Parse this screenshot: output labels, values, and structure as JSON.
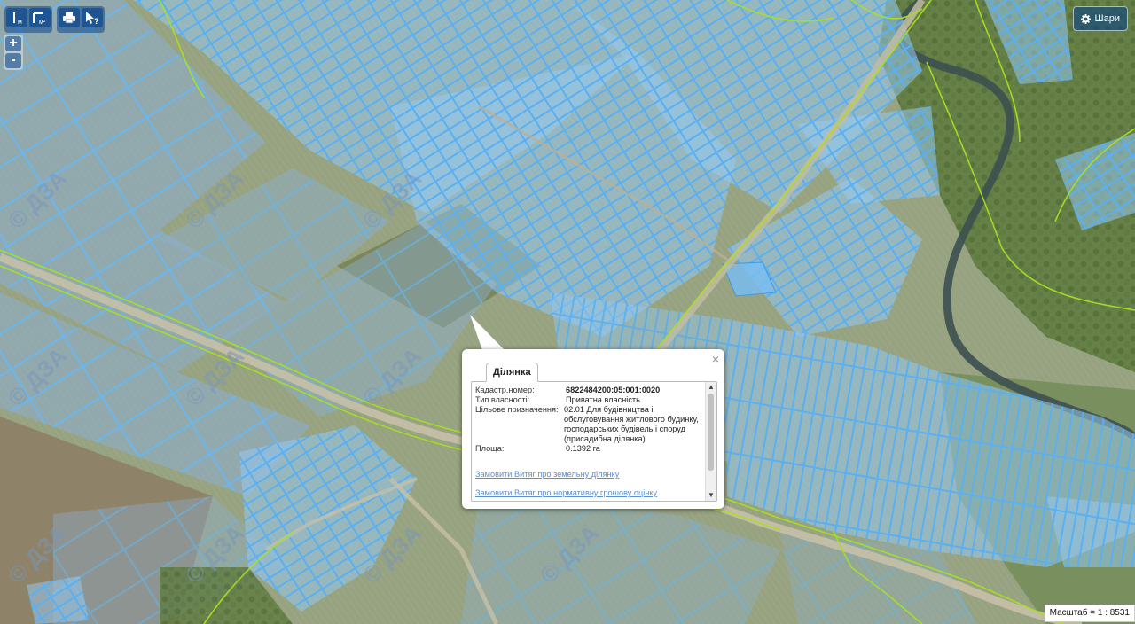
{
  "toolbar": {
    "measure_length_label": "м",
    "measure_area_label": "м²",
    "print_tool": "print-icon",
    "identify_tool": "pointer-question-icon"
  },
  "zoom": {
    "in_label": "+",
    "out_label": "-"
  },
  "layers_button": {
    "label": "Шари",
    "icon": "gear-icon"
  },
  "watermark": "© ДЗА",
  "popup": {
    "tab_label": "Ділянка",
    "close_label": "×",
    "fields": [
      {
        "key": "Кадастр.номер:",
        "value": "6822484200:05:001:0020",
        "bold": true
      },
      {
        "key": "Тип власності:",
        "value": "Приватна власність",
        "bold": false
      },
      {
        "key": "Цільове призначення:",
        "value": "02.01 Для будівництва і обслуговування житлового будинку, господарських будівель і споруд (присадибна ділянка)",
        "bold": false
      },
      {
        "key": "Площа:",
        "value": "0.1392 га",
        "bold": false
      }
    ],
    "links": [
      "Замовити Витяг про земельну ділянку",
      "Замовити Витяг про нормативну грошову оцінку"
    ]
  },
  "scale": {
    "text": "Масштаб = 1 : 8531"
  },
  "colors": {
    "parcel_fill": "#9cc8ec",
    "parcel_stroke": "#4aa8ee",
    "boundary_line": "#a8e020",
    "road": "#c8bfa8"
  }
}
